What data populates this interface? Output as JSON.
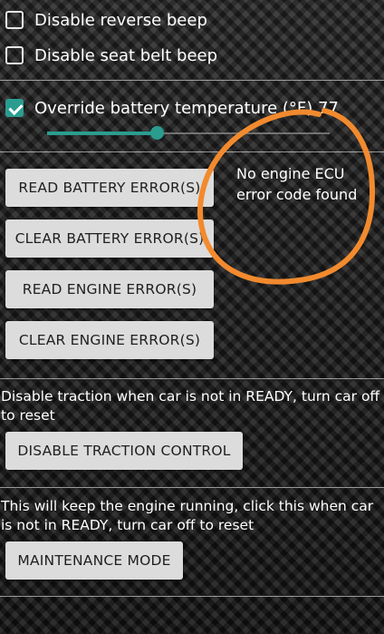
{
  "settings": {
    "disable_reverse_beep": {
      "label": "Disable reverse beep",
      "checked": false
    },
    "disable_seat_belt_beep": {
      "label": "Disable seat belt beep",
      "checked": false
    },
    "override_battery_temp": {
      "label": "Override battery temperature (°F) 77",
      "checked": true,
      "slider_level_fraction": 0.39
    }
  },
  "buttons": {
    "read_battery": "READ BATTERY ERROR(S)",
    "clear_battery": "CLEAR BATTERY ERROR(S)",
    "read_engine": "READ ENGINE ERROR(S)",
    "clear_engine": "CLEAR ENGINE ERROR(S)",
    "disable_traction": "DISABLE TRACTION CONTROL",
    "maintenance": "MAINTENANCE MODE"
  },
  "ecu_message": "No engine ECU error code found",
  "traction_desc": "Disable traction when car is not in READY, turn car off to reset",
  "maintenance_desc": "This will keep the engine running, click this when car is not in READY, turn car off to reset",
  "colors": {
    "accent": "#2a9d8f",
    "annotation": "#f28a2e",
    "button_bg": "#dcdcdc"
  },
  "icons": {
    "checkbox": "checkbox-icon",
    "checkbox_checked": "checkbox-checked-icon"
  }
}
